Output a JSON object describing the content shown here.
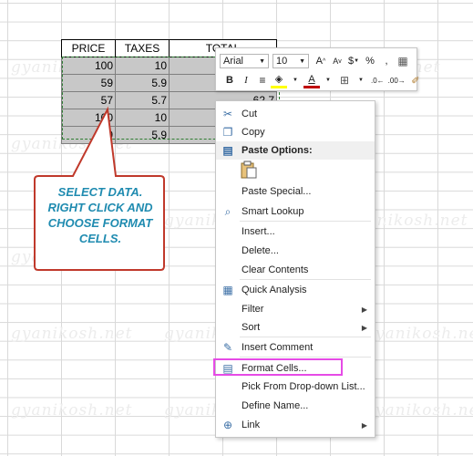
{
  "watermark": "gyanikosh.net",
  "table": {
    "headers": [
      "PRICE",
      "TAXES",
      "TOTAL"
    ],
    "rows": [
      {
        "price": "100",
        "taxes": "10",
        "total": ""
      },
      {
        "price": "59",
        "taxes": "5.9",
        "total": ""
      },
      {
        "price": "57",
        "taxes": "5.7",
        "total": "62.7"
      },
      {
        "price": "100",
        "taxes": "10",
        "total": ""
      },
      {
        "price": "59",
        "taxes": "5.9",
        "total": ""
      }
    ]
  },
  "callout": {
    "lines": [
      "SELECT DATA.",
      "RIGHT CLICK AND",
      "CHOOSE FORMAT",
      "CELLS."
    ],
    "fill_color": "#ffffff",
    "border_color": "#c0392b",
    "text_color": "#1f8bb0"
  },
  "mini_toolbar": {
    "font_name": "Arial",
    "font_size": "10",
    "grow_font": "A",
    "shrink_font": "A",
    "currency": "$",
    "percent": "%",
    "comma": ",",
    "bold": "B",
    "italic": "I",
    "font_color_letter": "A"
  },
  "context_menu": {
    "items": [
      {
        "label": "Cut",
        "icon": "scissors-icon",
        "glyph": "✂",
        "submenu": false
      },
      {
        "label": "Copy",
        "icon": "copy-icon",
        "glyph": "❐",
        "submenu": false
      },
      {
        "label": "Paste Options:",
        "icon": "paste-icon",
        "glyph": "▤",
        "submenu": false,
        "header": true
      },
      {
        "label": "Paste Special...",
        "icon": "",
        "glyph": "",
        "submenu": false
      },
      {
        "label": "Smart Lookup",
        "icon": "smart-lookup-icon",
        "glyph": "⌕",
        "submenu": false
      },
      {
        "label": "Insert...",
        "icon": "",
        "glyph": "",
        "submenu": false
      },
      {
        "label": "Delete...",
        "icon": "",
        "glyph": "",
        "submenu": false
      },
      {
        "label": "Clear Contents",
        "icon": "",
        "glyph": "",
        "submenu": false
      },
      {
        "label": "Quick Analysis",
        "icon": "quick-analysis-icon",
        "glyph": "▦",
        "submenu": false
      },
      {
        "label": "Filter",
        "icon": "",
        "glyph": "",
        "submenu": true
      },
      {
        "label": "Sort",
        "icon": "",
        "glyph": "",
        "submenu": true
      },
      {
        "label": "Insert Comment",
        "icon": "insert-comment-icon",
        "glyph": "✎",
        "submenu": false
      },
      {
        "label": "Format Cells...",
        "icon": "format-cells-icon",
        "glyph": "▤",
        "submenu": false
      },
      {
        "label": "Pick From Drop-down List...",
        "icon": "",
        "glyph": "",
        "submenu": false
      },
      {
        "label": "Define Name...",
        "icon": "",
        "glyph": "",
        "submenu": false
      },
      {
        "label": "Link",
        "icon": "link-icon",
        "glyph": "⊕",
        "submenu": true
      }
    ],
    "highlight_color": "#e64be6"
  }
}
